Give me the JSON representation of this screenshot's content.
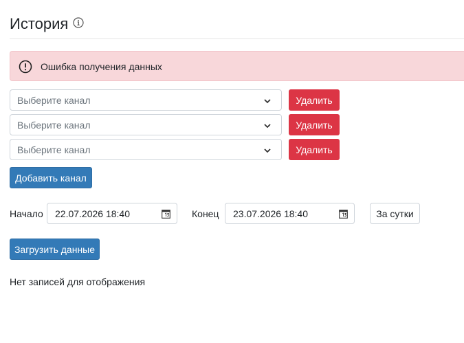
{
  "header": {
    "title": "История",
    "info_icon": "info-icon"
  },
  "alert": {
    "icon": "exclamation-circle-icon",
    "text": "Ошибка получения данных",
    "background": "#f8d7da"
  },
  "channels": [
    {
      "placeholder": "Выберите канал",
      "remove_label": "Удалить"
    },
    {
      "placeholder": "Выберите канал",
      "remove_label": "Удалить"
    },
    {
      "placeholder": "Выберите канал",
      "remove_label": "Удалить"
    }
  ],
  "add_channel_label": "Добавить канал",
  "period": {
    "start_label": "Начало",
    "start_value": "22.07.2026 18:40",
    "end_label": "Конец",
    "end_value": "23.07.2026 18:40",
    "day_button": "За сутки"
  },
  "load_button": "Загрузить данные",
  "empty_text": "Нет записей для отображения",
  "colors": {
    "danger": "#dc3545",
    "primary": "#337ab7"
  }
}
